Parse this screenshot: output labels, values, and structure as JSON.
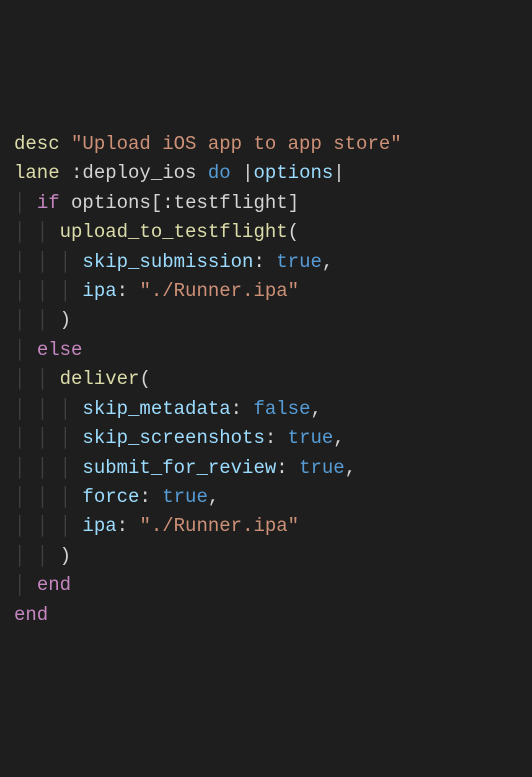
{
  "code": {
    "line1": {
      "desc": "desc",
      "string": "\"Upload iOS app to app store\""
    },
    "line2": {
      "lane": "lane",
      "symbol": ":deploy_ios",
      "do": "do",
      "options": "options"
    },
    "line3": {
      "if": "if",
      "var": "options",
      "key": ":testflight"
    },
    "line4": {
      "method": "upload_to_testflight"
    },
    "line5": {
      "key": "skip_submission",
      "val": "true"
    },
    "line6": {
      "key": "ipa",
      "val": "\"./Runner.ipa\""
    },
    "line8": {
      "else": "else"
    },
    "line9": {
      "method": "deliver"
    },
    "line10": {
      "key": "skip_metadata",
      "val": "false"
    },
    "line11": {
      "key": "skip_screenshots",
      "val": "true"
    },
    "line12": {
      "key": "submit_for_review",
      "val": "true"
    },
    "line13": {
      "key": "force",
      "val": "true"
    },
    "line14": {
      "key": "ipa",
      "val": "\"./Runner.ipa\""
    },
    "line16": {
      "end": "end"
    },
    "line17": {
      "end": "end"
    }
  }
}
